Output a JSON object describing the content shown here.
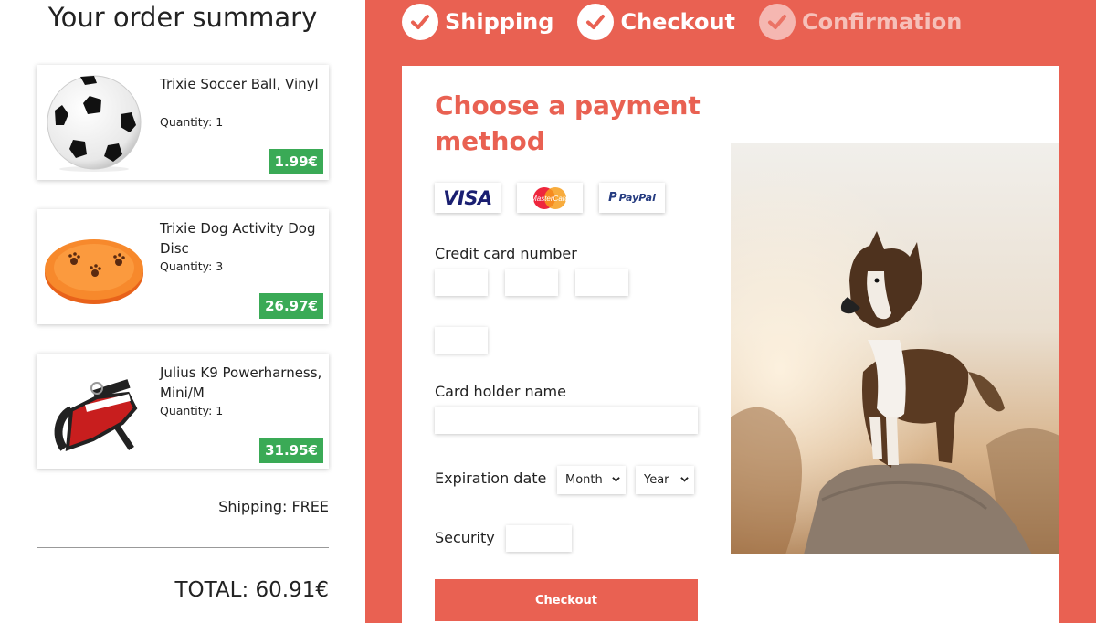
{
  "summary": {
    "title": "Your order summary",
    "items": [
      {
        "name": "Trixie Soccer Ball, Vinyl",
        "quantity": "Quantity: 1",
        "price": "1.99€",
        "image": "soccer-ball"
      },
      {
        "name": "Trixie Dog Activity Dog Disc",
        "quantity": "Quantity: 3",
        "price": "26.97€",
        "image": "orange-disc"
      },
      {
        "name": "Julius K9 Powerharness, Mini/M",
        "quantity": "Quantity: 1",
        "price": "31.95€",
        "image": "red-harness"
      }
    ],
    "shipping": "Shipping: FREE",
    "total": "TOTAL: 60.91€"
  },
  "steps": [
    {
      "label": "Shipping",
      "icon": "check-icon",
      "state": "done"
    },
    {
      "label": "Checkout",
      "icon": "check-icon",
      "state": "done"
    },
    {
      "label": "Confirmation",
      "icon": "check-icon",
      "state": "pending"
    }
  ],
  "payment": {
    "title": "Choose a payment method",
    "methods": [
      {
        "name": "VISA",
        "icon": "visa-logo"
      },
      {
        "name": "MasterCard",
        "icon": "mastercard-logo"
      },
      {
        "name": "PayPal",
        "icon": "paypal-logo"
      }
    ],
    "card_number_label": "Credit card number",
    "holder_label": "Card holder name",
    "expiration_label": "Expiration date",
    "month_select": "Month",
    "year_select": "Year",
    "security_label": "Security",
    "checkout_button": "Checkout"
  },
  "colors": {
    "accent": "#e96152",
    "price_badge": "#3aaa56",
    "visa_blue": "#1a1f71"
  }
}
